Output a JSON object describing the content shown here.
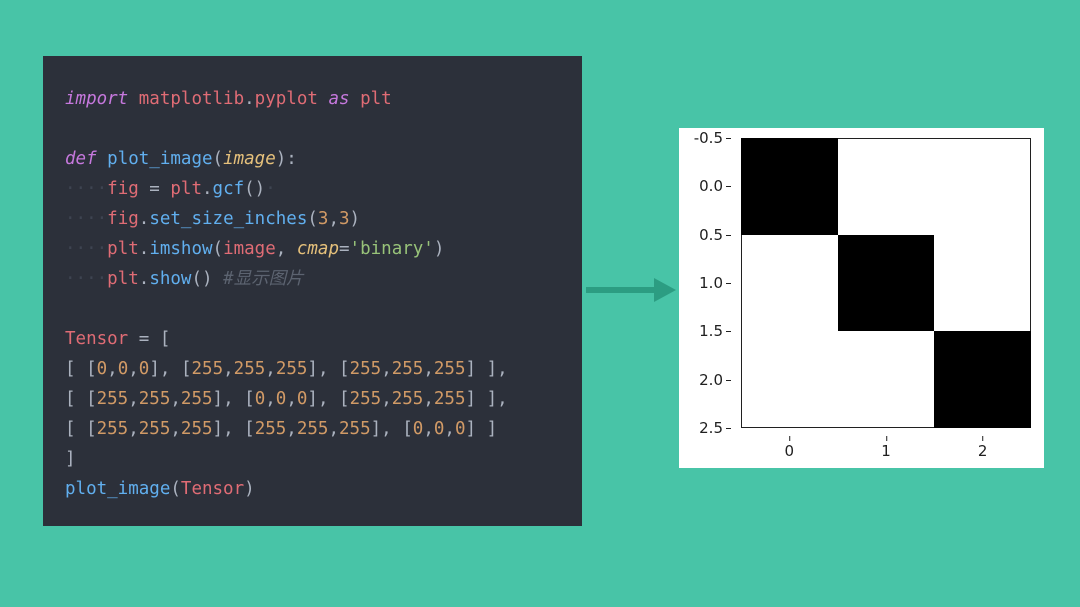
{
  "code": {
    "l1": {
      "kw1": "import",
      "mod": "matplotlib",
      "dot": ".",
      "sub": "pyplot",
      "kw2": "as",
      "alias": "plt"
    },
    "l3": {
      "kw": "def",
      "fn": "plot_image",
      "lp": "(",
      "param": "image",
      "rp": "):"
    },
    "l4": {
      "indent": "····",
      "var": "fig",
      "eq": " = ",
      "obj": "plt",
      "dot": ".",
      "method": "gcf",
      "call": "()",
      "trail": "·"
    },
    "l5": {
      "indent": "····",
      "obj": "fig",
      "dot": ".",
      "method": "set_size_inches",
      "lp": "(",
      "a1": "3",
      "comma": ",",
      "a2": "3",
      "rp": ")"
    },
    "l6": {
      "indent": "····",
      "obj": "plt",
      "dot": ".",
      "method": "imshow",
      "lp": "(",
      "arg": "image",
      "comma": ", ",
      "kwarg": "cmap",
      "eq": "=",
      "val": "'binary'",
      "rp": ")"
    },
    "l7": {
      "indent": "····",
      "obj": "plt",
      "dot": ".",
      "method": "show",
      "call": "()",
      "sp": " ",
      "comment": "#显示图片"
    },
    "l9": {
      "var": "Tensor",
      "eq": " = ["
    },
    "l10": "[ [0,0,0], [255,255,255], [255,255,255] ],",
    "l11": "[ [255,255,255], [0,0,0], [255,255,255] ],",
    "l12": "[ [255,255,255], [255,255,255], [0,0,0] ]",
    "l13": "]",
    "l14": {
      "fn": "plot_image",
      "lp": "(",
      "arg": "Tensor",
      "rp": ")"
    }
  },
  "chart_data": {
    "type": "heatmap",
    "title": "",
    "xlabel": "",
    "ylabel": "",
    "xticks": [
      "0",
      "1",
      "2"
    ],
    "yticks": [
      "-0.5",
      "0.0",
      "0.5",
      "1.0",
      "1.5",
      "2.0",
      "2.5"
    ],
    "xlim": [
      -0.5,
      2.5
    ],
    "ylim": [
      2.5,
      -0.5
    ],
    "cmap": "binary",
    "matrix": [
      [
        [
          0,
          0,
          0
        ],
        [
          255,
          255,
          255
        ],
        [
          255,
          255,
          255
        ]
      ],
      [
        [
          255,
          255,
          255
        ],
        [
          0,
          0,
          0
        ],
        [
          255,
          255,
          255
        ]
      ],
      [
        [
          255,
          255,
          255
        ],
        [
          255,
          255,
          255
        ],
        [
          0,
          0,
          0
        ]
      ]
    ]
  }
}
